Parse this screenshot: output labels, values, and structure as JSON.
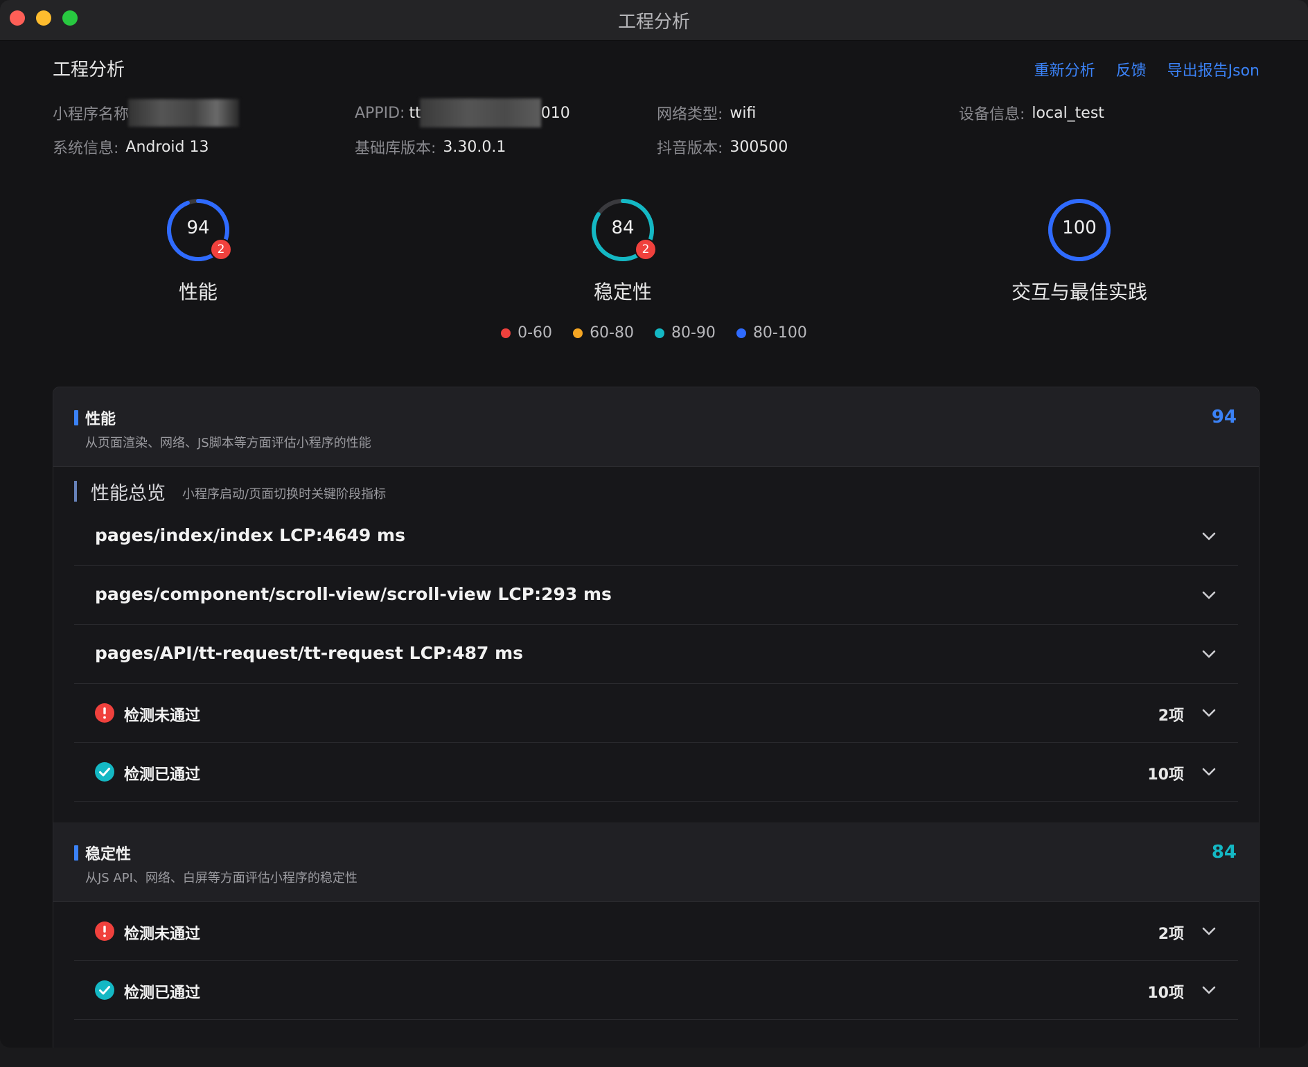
{
  "window": {
    "title": "工程分析"
  },
  "header": {
    "title": "工程分析",
    "actions": [
      "重新分析",
      "反馈",
      "导出报告Json"
    ]
  },
  "info": {
    "mini_name_label": "小程序名称:",
    "appid_label": "APPID:",
    "appid_prefix": "tt",
    "appid_suffix": "010",
    "network_label": "网络类型:",
    "network_value": "wifi",
    "device_label": "设备信息:",
    "device_value": "local_test",
    "system_label": "系统信息:",
    "system_value": "Android 13",
    "sdk_label": "基础库版本:",
    "sdk_value": "3.30.0.1",
    "douyin_label": "抖音版本:",
    "douyin_value": "300500"
  },
  "gauges": [
    {
      "score": "94",
      "label": "性能",
      "badge": "2",
      "fraction": 0.94,
      "color": "#2f6bff"
    },
    {
      "score": "84",
      "label": "稳定性",
      "badge": "2",
      "fraction": 0.84,
      "color": "#14b8c4"
    },
    {
      "score": "100",
      "label": "交互与最佳实践",
      "badge": "",
      "fraction": 1.0,
      "color": "#2f6bff"
    }
  ],
  "legend": [
    {
      "label": "0-60",
      "color": "#f0413d"
    },
    {
      "label": "60-80",
      "color": "#f5a623"
    },
    {
      "label": "80-90",
      "color": "#14b8c4"
    },
    {
      "label": "80-100",
      "color": "#2f6bff"
    }
  ],
  "performance": {
    "title": "性能",
    "desc": "从页面渲染、网络、JS脚本等方面评估小程序的性能",
    "score": "94",
    "score_color": "#3b82f6",
    "overview_title": "性能总览",
    "overview_desc": "小程序启动/页面切换时关键阶段指标",
    "pages": [
      "pages/index/index LCP:4649 ms",
      "pages/component/scroll-view/scroll-view LCP:293 ms",
      "pages/API/tt-request/tt-request LCP:487 ms"
    ],
    "failed_label": "检测未通过",
    "failed_count": "2项",
    "passed_label": "检测已通过",
    "passed_count": "10项"
  },
  "stability": {
    "title": "稳定性",
    "desc": "从JS API、网络、白屏等方面评估小程序的稳定性",
    "score": "84",
    "score_color": "#14b8c4",
    "failed_label": "检测未通过",
    "failed_count": "2项",
    "passed_label": "检测已通过",
    "passed_count": "10项"
  },
  "icons": {
    "chevron": "chevron-down-icon",
    "error": "error-icon",
    "success": "check-circle-icon"
  }
}
